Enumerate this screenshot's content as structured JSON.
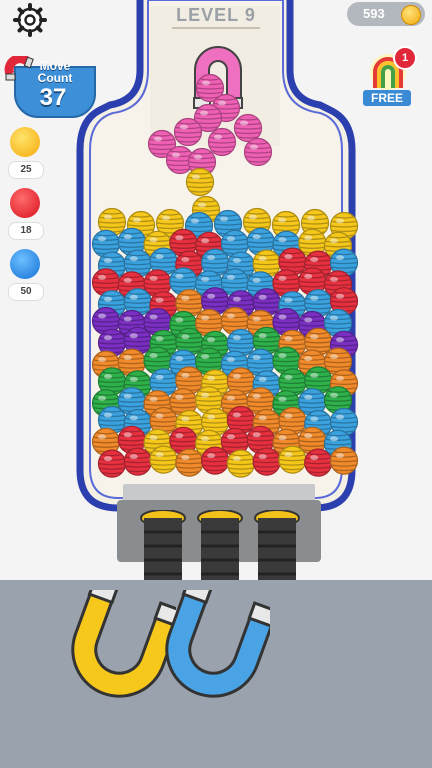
{
  "header": {
    "settings_icon": "gear-icon",
    "level_text": "LEVEL 9",
    "coins": "593"
  },
  "move_count": {
    "label": "Move Count",
    "value": "37",
    "icon": "magnet-icon"
  },
  "counters": [
    {
      "color": "#f7b90f",
      "value": "25"
    },
    {
      "color": "#e7232f",
      "value": "18"
    },
    {
      "color": "#1f83e6",
      "value": "50"
    }
  ],
  "free_powerup": {
    "label": "FREE",
    "badge": "1",
    "icon": "rainbow-magnet-icon"
  },
  "magnets": [
    {
      "name": "yellow-magnet",
      "color": "#f6c81c"
    },
    {
      "name": "blue-magnet",
      "color": "#4aa3e4"
    }
  ],
  "colors": {
    "yellow": "#f5c71a",
    "blue": "#3ba2e0",
    "red": "#e63040",
    "orange": "#f08a2a",
    "purple": "#7a2fc2",
    "green": "#2eb14a",
    "pink": "#ef5fb4"
  },
  "falling_balls": [
    "pink",
    "pink",
    "pink",
    "pink",
    "pink",
    "pink",
    "pink",
    "pink",
    "pink",
    "pink",
    "yellow",
    "yellow"
  ],
  "ball_rows": [
    [
      "yellow",
      "yellow",
      "yellow",
      "blue",
      "blue",
      "yellow",
      "yellow",
      "yellow",
      "yellow"
    ],
    [
      "blue",
      "blue",
      "yellow",
      "red",
      "red",
      "blue",
      "blue",
      "blue",
      "yellow",
      "yellow"
    ],
    [
      "blue",
      "blue",
      "blue",
      "red",
      "blue",
      "blue",
      "yellow",
      "red",
      "red",
      "blue"
    ],
    [
      "red",
      "red",
      "red",
      "blue",
      "blue",
      "blue",
      "blue",
      "red",
      "red",
      "red"
    ],
    [
      "blue",
      "blue",
      "red",
      "orange",
      "purple",
      "purple",
      "purple",
      "blue",
      "blue",
      "red"
    ],
    [
      "purple",
      "purple",
      "purple",
      "green",
      "orange",
      "orange",
      "orange",
      "purple",
      "purple",
      "blue"
    ],
    [
      "purple",
      "purple",
      "green",
      "green",
      "green",
      "blue",
      "green",
      "orange",
      "orange",
      "purple"
    ],
    [
      "orange",
      "orange",
      "green",
      "blue",
      "green",
      "blue",
      "blue",
      "green",
      "orange",
      "orange"
    ],
    [
      "green",
      "green",
      "blue",
      "orange",
      "yellow",
      "orange",
      "blue",
      "green",
      "green",
      "orange"
    ],
    [
      "green",
      "blue",
      "orange",
      "orange",
      "yellow",
      "orange",
      "orange",
      "green",
      "blue",
      "green"
    ],
    [
      "blue",
      "blue",
      "orange",
      "yellow",
      "yellow",
      "red",
      "orange",
      "orange",
      "blue",
      "blue"
    ],
    [
      "orange",
      "red",
      "yellow",
      "red",
      "yellow",
      "red",
      "red",
      "orange",
      "orange",
      "blue"
    ],
    [
      "red",
      "red",
      "yellow",
      "orange",
      "red",
      "yellow",
      "red",
      "yellow",
      "red",
      "orange"
    ]
  ]
}
